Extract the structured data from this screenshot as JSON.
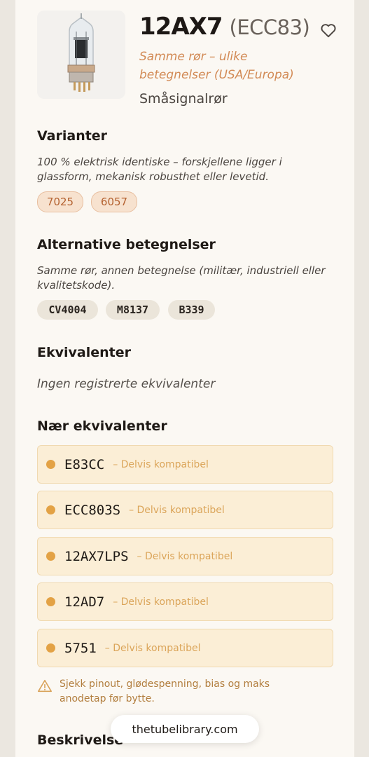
{
  "tube": {
    "name": "12AX7",
    "alt_name": "(ECC83)",
    "subtitle": "Samme rør – ulike betegnelser (USA/Europa)",
    "type": "Småsignalrør"
  },
  "variants": {
    "heading": "Varianter",
    "description": "100 % elektrisk identiske – forskjellene ligger i glassform, mekanisk robusthet eller levetid.",
    "items": [
      "7025",
      "6057"
    ]
  },
  "alternatives": {
    "heading": "Alternative betegnelser",
    "description": "Samme rør, annen betegnelse (militær, industriell eller kvalitetskode).",
    "items": [
      "CV4004",
      "M8137",
      "B339"
    ]
  },
  "equivalents": {
    "heading": "Ekvivalenter",
    "empty_text": "Ingen registrerte ekvivalenter"
  },
  "near_equivalents": {
    "heading": "Nær ekvivalenter",
    "items": [
      {
        "name": "E83CC",
        "tag": "– Delvis kompatibel"
      },
      {
        "name": "ECC803S",
        "tag": "– Delvis kompatibel"
      },
      {
        "name": "12AX7LPS",
        "tag": "– Delvis kompatibel"
      },
      {
        "name": "12AD7",
        "tag": "– Delvis kompatibel"
      },
      {
        "name": "5751",
        "tag": "– Delvis kompatibel"
      }
    ]
  },
  "warning": "Sjekk pinout, glødespenning, bias og maks anodetap før bytte.",
  "description_heading": "Beskrivelse",
  "site_badge": "thetubelibrary.com",
  "icons": {
    "favorite": "heart-outline-icon",
    "warning": "warning-triangle-icon",
    "status_dot": "status-dot-icon"
  },
  "colors": {
    "accent": "#d28a55",
    "status": "#e3a245"
  }
}
